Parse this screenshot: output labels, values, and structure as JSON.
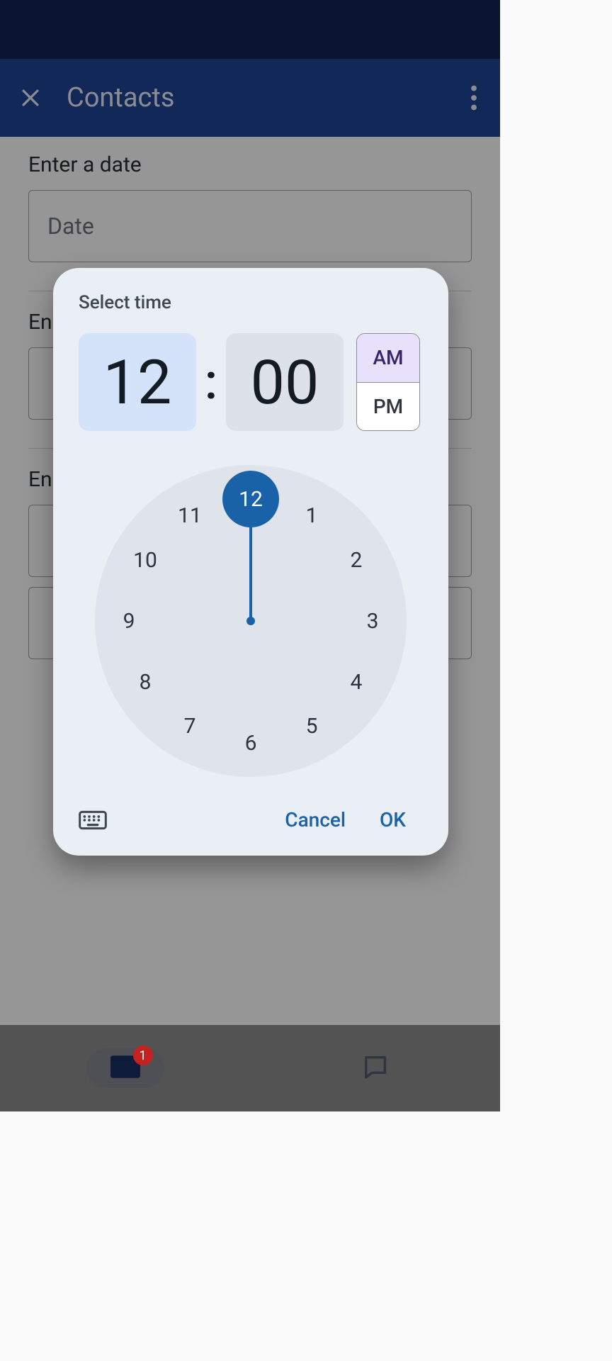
{
  "appbar": {
    "title": "Contacts"
  },
  "form": {
    "date_label": "Enter a date",
    "date_placeholder": "Date",
    "section2_label_partial": "En",
    "section3_label_partial": "En"
  },
  "timepicker": {
    "title": "Select time",
    "hour": "12",
    "minute": "00",
    "am_label": "AM",
    "pm_label": "PM",
    "selected_period": "AM",
    "clock_hours": [
      "12",
      "1",
      "2",
      "3",
      "4",
      "5",
      "6",
      "7",
      "8",
      "9",
      "10",
      "11"
    ],
    "selected_hour_index": 0,
    "cancel_label": "Cancel",
    "ok_label": "OK"
  },
  "bottomnav": {
    "badge_count": "1"
  }
}
